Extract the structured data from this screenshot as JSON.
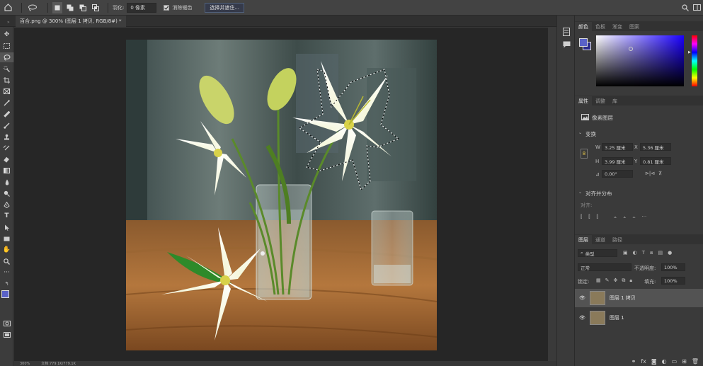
{
  "options_bar": {
    "feather_label": "羽化:",
    "feather_value": "0 像素",
    "antialias_label": "消除锯齿",
    "select_mask_label": "选择并遮住..."
  },
  "document": {
    "tab_title": "百合.png @ 300% (图层 1 拷贝, RGB/8#) *",
    "zoom": "300%",
    "doc_info": "文档:779.1K/779.1K"
  },
  "panels": {
    "color_tabs": [
      "颜色",
      "色板",
      "渐变",
      "图案"
    ],
    "props_tabs": [
      "属性",
      "调整",
      "库"
    ],
    "pixel_layer_label": "像素图层",
    "transform_label": "变换",
    "w_label": "W",
    "w_value": "3.25 厘米",
    "x_label": "X",
    "x_value": "5.36 厘米",
    "h_label": "H",
    "h_value": "3.99 厘米",
    "y_label": "Y",
    "y_value": "0.81 厘米",
    "angle_value": "0.00°",
    "align_label": "对齐并分布",
    "align_sub": "对齐:",
    "layers_tabs": [
      "图层",
      "通道",
      "路径"
    ],
    "kind_label": "类型",
    "blend_mode": "正常",
    "opacity_label": "不透明度:",
    "opacity_value": "100%",
    "lock_label": "锁定:",
    "fill_label": "填充:",
    "fill_value": "100%",
    "layers": [
      {
        "name": "图层 1 拷贝"
      },
      {
        "name": "图层 1"
      }
    ]
  },
  "colors": {
    "foreground": "#5a62c8",
    "background": "#2a2a8a",
    "picker_hue": "#1a00ff"
  }
}
